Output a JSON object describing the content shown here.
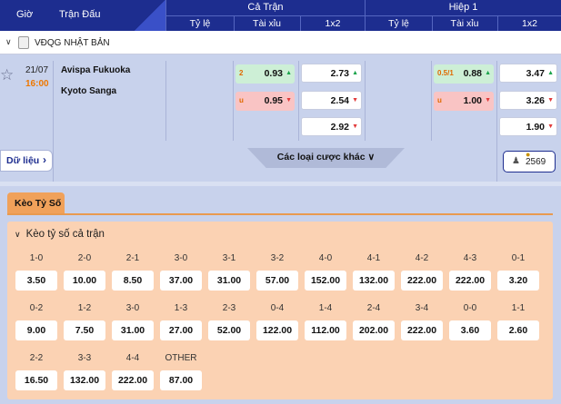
{
  "header": {
    "col_time": "Giờ",
    "col_match": "Trận Đấu",
    "full_match": "Cả Trận",
    "half1": "Hiệp 1",
    "sub_handicap": "Tỷ lệ",
    "sub_overunder": "Tài xỉu",
    "sub_1x2": "1x2"
  },
  "league": {
    "name": "VĐQG NHẬT BẢN"
  },
  "match": {
    "date": "21/07",
    "time": "16:00",
    "home": "Avispa Fukuoka",
    "away": "Kyoto Sanga",
    "ft_ou": [
      {
        "label": "2",
        "value": "0.93",
        "dir": "up"
      },
      {
        "label": "u",
        "value": "0.95",
        "dir": "down"
      }
    ],
    "ft_1x2": [
      {
        "value": "2.73",
        "dir": "up"
      },
      {
        "value": "2.54",
        "dir": "down"
      },
      {
        "value": "2.92",
        "dir": "down"
      }
    ],
    "h1_ou": [
      {
        "label": "0.5/1",
        "value": "0.88",
        "dir": "up"
      },
      {
        "label": "u",
        "value": "1.00",
        "dir": "down"
      }
    ],
    "h1_1x2": [
      {
        "value": "3.47",
        "dir": "up"
      },
      {
        "value": "3.26",
        "dir": "down"
      },
      {
        "value": "1.90",
        "dir": "down"
      }
    ],
    "data_button": "Dữ liệu",
    "other_bets": "Các loại cược khác",
    "count": "2569"
  },
  "correct_score": {
    "tab": "Kèo Tỷ Số",
    "title": "Kèo tỷ số cả trận",
    "rows": [
      [
        {
          "score": "1-0",
          "odd": "3.50"
        },
        {
          "score": "2-0",
          "odd": "10.00"
        },
        {
          "score": "2-1",
          "odd": "8.50"
        },
        {
          "score": "3-0",
          "odd": "37.00"
        },
        {
          "score": "3-1",
          "odd": "31.00"
        },
        {
          "score": "3-2",
          "odd": "57.00"
        },
        {
          "score": "4-0",
          "odd": "152.00"
        },
        {
          "score": "4-1",
          "odd": "132.00"
        },
        {
          "score": "4-2",
          "odd": "222.00"
        },
        {
          "score": "4-3",
          "odd": "222.00"
        },
        {
          "score": "0-1",
          "odd": "3.20"
        }
      ],
      [
        {
          "score": "0-2",
          "odd": "9.00"
        },
        {
          "score": "1-2",
          "odd": "7.50"
        },
        {
          "score": "3-0",
          "odd": "31.00"
        },
        {
          "score": "1-3",
          "odd": "27.00"
        },
        {
          "score": "2-3",
          "odd": "52.00"
        },
        {
          "score": "0-4",
          "odd": "122.00"
        },
        {
          "score": "1-4",
          "odd": "112.00"
        },
        {
          "score": "2-4",
          "odd": "202.00"
        },
        {
          "score": "3-4",
          "odd": "222.00"
        },
        {
          "score": "0-0",
          "odd": "3.60"
        },
        {
          "score": "1-1",
          "odd": "2.60"
        }
      ],
      [
        {
          "score": "2-2",
          "odd": "16.50"
        },
        {
          "score": "3-3",
          "odd": "132.00"
        },
        {
          "score": "4-4",
          "odd": "222.00"
        },
        {
          "score": "OTHER",
          "odd": "87.00"
        }
      ]
    ]
  },
  "colors": {
    "header_bg": "#1d2d8f",
    "panel_bg": "#fbd2b3",
    "tab_bg": "#f0a15a",
    "up": "#1aa34a",
    "down": "#e23a3a",
    "time": "#ee7700"
  },
  "icons": [
    "star-icon",
    "chevron-down-icon",
    "chevron-right-icon",
    "user-group-icon",
    "lock-icon",
    "league-logo-icon"
  ]
}
